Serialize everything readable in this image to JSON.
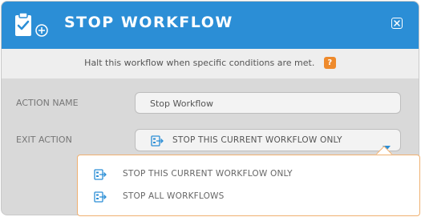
{
  "dialog": {
    "title": "STOP WORKFLOW",
    "header_icon": "clipboard-check-plus-icon",
    "close_icon": "close-icon",
    "description": "Halt this workflow when specific conditions are met.",
    "help_badge": "?",
    "colors": {
      "header": "#2b8ed6",
      "accent": "#ee8a2c",
      "dropdown_border": "#f0b070"
    }
  },
  "form": {
    "action_name": {
      "label": "ACTION NAME",
      "value": "Stop Workflow"
    },
    "exit_action": {
      "label": "EXIT ACTION",
      "selected": "STOP THIS CURRENT WORKFLOW ONLY",
      "icon": "workflow-exit-icon",
      "options": [
        "STOP THIS CURRENT WORKFLOW ONLY",
        "STOP ALL WORKFLOWS"
      ]
    }
  }
}
